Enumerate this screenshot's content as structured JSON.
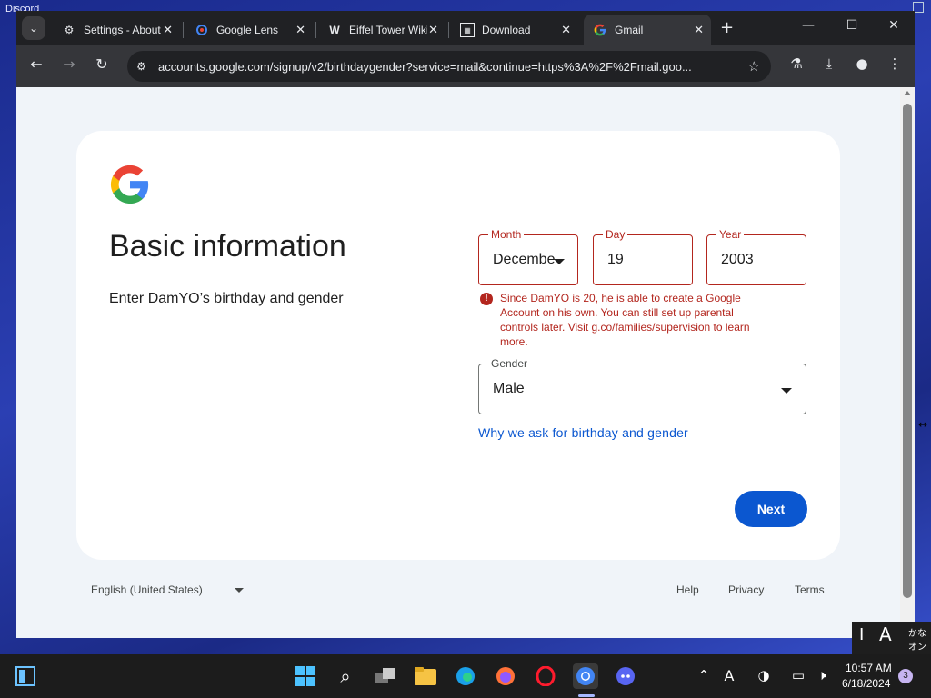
{
  "desktop": {
    "label": "Discord"
  },
  "tabs": [
    {
      "title": "Settings - About",
      "icon": "gear-icon"
    },
    {
      "title": "Google Lens",
      "icon": "google-lens-icon"
    },
    {
      "title": "Eiffel Tower Wiki",
      "icon": "wiki-icon"
    },
    {
      "title": "Download",
      "icon": "download-site-icon"
    },
    {
      "title": "Gmail",
      "icon": "google-icon"
    }
  ],
  "toolbar": {
    "url": "accounts.google.com/signup/v2/birthdaygender?service=mail&continue=https%3A%2F%2Fmail.goo..."
  },
  "page": {
    "title": "Basic information",
    "subtitle": "Enter DamYO’s birthday and gender",
    "month": {
      "label": "Month",
      "value": "December"
    },
    "day": {
      "label": "Day",
      "value": "19"
    },
    "year": {
      "label": "Year",
      "value": "2003"
    },
    "error": "Since DamYO is 20, he is able to create a Google Account on his own. You can still set up parental controls later. Visit g.co/families/supervision to learn more.",
    "gender": {
      "label": "Gender",
      "value": "Male"
    },
    "why_link": "Why we ask for birthday and gender",
    "next_label": "Next"
  },
  "footer": {
    "language": "English (United States)",
    "help": "Help",
    "privacy": "Privacy",
    "terms": "Terms"
  },
  "ime": {
    "cursor": "I",
    "mode": "A",
    "kana_top": "かな",
    "kana_bottom": "オン"
  },
  "taskbar": {
    "time": "10:57 AM",
    "date": "6/18/2024",
    "notification_count": "3"
  },
  "colors": {
    "accent": "#0b57d0",
    "error": "#b3261e",
    "page_bg": "#f0f4f9"
  }
}
